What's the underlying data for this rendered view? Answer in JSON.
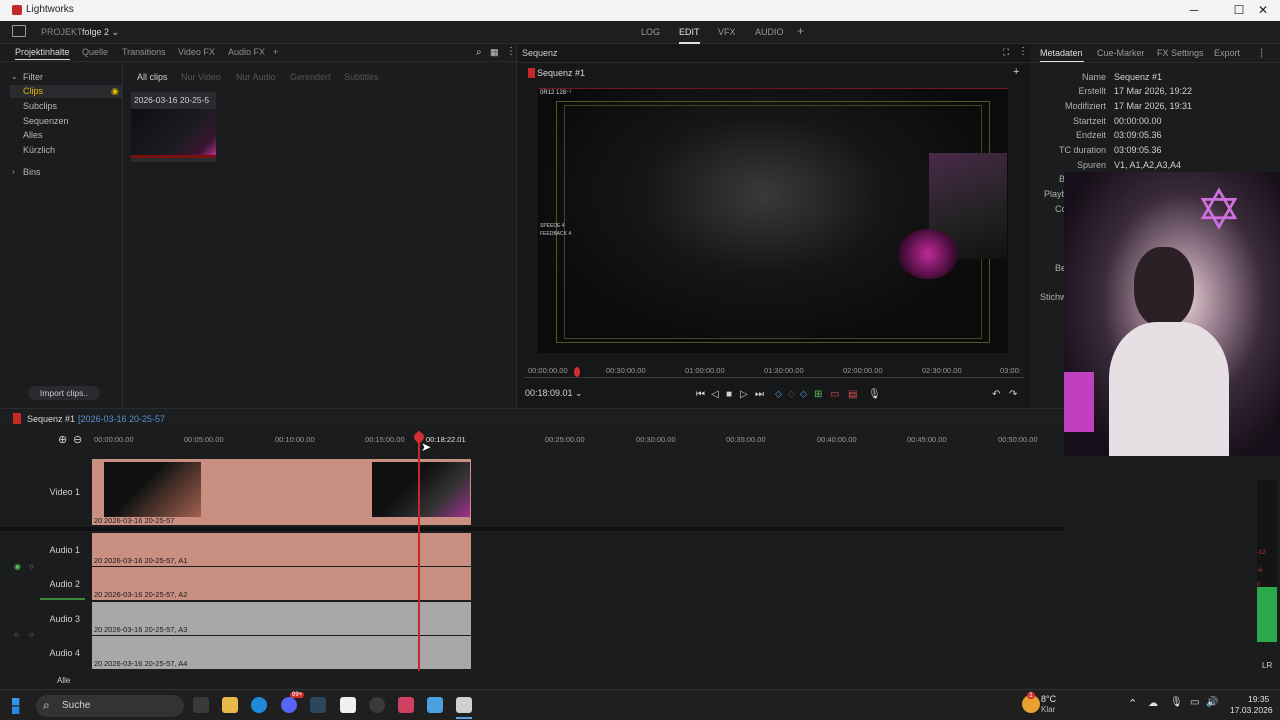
{
  "window": {
    "app_title": "Lightworks",
    "minimize": "─",
    "maximize": "☐",
    "close": "✕"
  },
  "menubar": {
    "project_label": "PROJEKT",
    "project_name": "folge 2",
    "tabs": [
      "LOG",
      "EDIT",
      "VFX",
      "AUDIO"
    ],
    "add": "+"
  },
  "left_panel": {
    "tabs": [
      "Projektinhalte",
      "Quelle",
      "Transitions",
      "Video FX",
      "Audio FX"
    ],
    "add": "+",
    "filter_label": "Filter",
    "filter_items": [
      "Clips",
      "Subclips",
      "Sequenzen",
      "Alles",
      "Kürzlich"
    ],
    "bins_label": "Bins",
    "subtabs": [
      "All clips",
      "Nur Video",
      "Nur Audio",
      "Gerendert",
      "Subtitles"
    ],
    "clip_name": "2026-03-16 20-25-5",
    "import_button": "Import clips.."
  },
  "viewer": {
    "panel_title": "Sequenz",
    "sequence_name": "Sequenz #1",
    "add": "+",
    "ruler_ticks": [
      "00:00:00.00",
      "00:30:00.00",
      "01:00:00.00",
      "01:30:00.00",
      "02:00:00.00",
      "02:30:00.00",
      "03:00:"
    ],
    "timecode": "00:18:09.01",
    "overlay_left_top": "0R12",
    "overlay_left_top2": "128⁻¹",
    "overlay_left_mid1": "SPEEDE 4",
    "overlay_left_mid2": "FEEDBACK 4"
  },
  "metadata": {
    "tabs": [
      "Metadaten",
      "Cue-Marker",
      "FX Settings",
      "Export"
    ],
    "rows": [
      {
        "key": "Name",
        "value": "Sequenz #1"
      },
      {
        "key": "Erstellt",
        "value": "17 Mar 2026, 19:22"
      },
      {
        "key": "Modifiziert",
        "value": "17 Mar 2026, 19:31"
      },
      {
        "key": "Startzeit",
        "value": "00:00:00.00"
      },
      {
        "key": "Endzeit",
        "value": "03:09:05.36"
      },
      {
        "key": "TC duration",
        "value": "03:09:05.36"
      },
      {
        "key": "Spuren",
        "value": "V1, A1,A2,A3,A4"
      }
    ],
    "partial_labels": [
      "Bi",
      "Playb",
      "Co",
      "Be",
      "Stichw"
    ]
  },
  "timeline": {
    "sequence_name": "Sequenz #1",
    "clip_ref": "[2026-03-16 20-25-57",
    "ruler_ticks": [
      "00:00:00.00",
      "00:05:00.00",
      "00:10:00.00",
      "00:15:00.00",
      "00:18:22.01",
      "00:25:00.00",
      "00:30:00.00",
      "00:35:00.00",
      "00:40:00.00",
      "00:45:00.00",
      "00:50:00.00"
    ],
    "tracks": [
      {
        "label": "Video 1",
        "clip": "2026-03-16 20-25-57"
      },
      {
        "label": "Audio 1",
        "clip": "2026-03-16 20-25-57, A1"
      },
      {
        "label": "Audio 2",
        "clip": "2026-03-16 20-25-57, A2"
      },
      {
        "label": "Audio 3",
        "clip": "2026-03-16 20-25-57, A3"
      },
      {
        "label": "Audio 4",
        "clip": "2026-03-16 20-25-57, A4"
      }
    ],
    "all_label": "Alle",
    "clip_prefix": "20",
    "lr_label": "LR",
    "vu_ticks": [
      "-12",
      "-6",
      "0"
    ]
  },
  "taskbar": {
    "search_placeholder": "Suche",
    "weather_temp": "8°C",
    "weather_desc": "Klar",
    "time": "19:35",
    "date": "17.03.2026",
    "badge": "1",
    "notif_badge": "99+"
  },
  "colors": {
    "accent_red": "#c62828",
    "selected_yellow": "#e6b800",
    "clip_pink": "#c98f80",
    "clip_grey": "#a8a8a8"
  }
}
